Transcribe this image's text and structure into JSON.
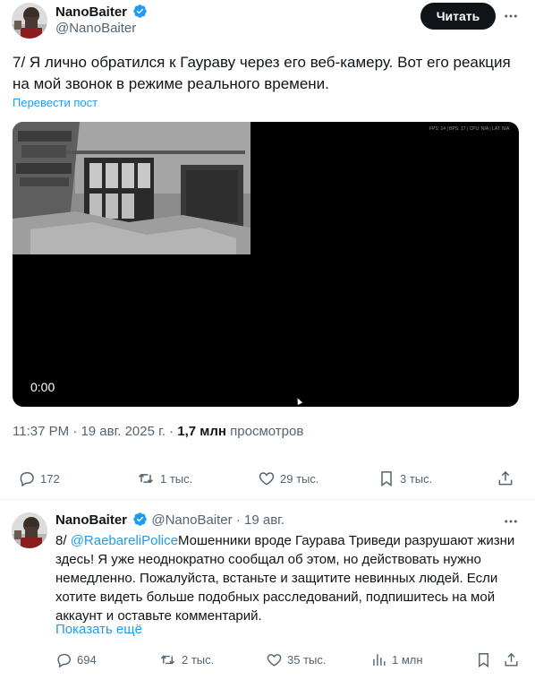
{
  "post": {
    "author_name": "NanoBaiter",
    "author_handle": "@NanoBaiter",
    "follow_label": "Читать",
    "text": "7/ Я лично обратился к Гаураву через его веб-камеру. Вот его реакция на мой звонок в режиме реального времени.",
    "translate_label": "Перевести пост",
    "video": {
      "timecode": "0:00",
      "stats_overlay": "FPS: 14 | BPS: 17 | CPU: N/A | LAT: N/A"
    },
    "time": "11:37 PM",
    "date": "19 авг. 2025 г.",
    "views_count": "1,7 млн",
    "views_label": "просмотров",
    "actions": {
      "replies": "172",
      "reposts": "1 тыс.",
      "likes": "29 тыс.",
      "bookmarks": "3 тыс."
    }
  },
  "reply": {
    "author_name": "NanoBaiter",
    "author_handle": "@NanoBaiter",
    "date": "19 авг.",
    "number": "8/",
    "mention": "@RaebareliPolice",
    "text": "Мошенники вроде Гаурава Триведи разрушают жизни здесь! Я уже неоднократно сообщал об этом, но действовать нужно немедленно. Пожалуйста, встаньте и защитите невинных людей. Если хотите видеть больше подобных расследований, подпишитесь на мой аккаунт и оставьте комментарий.",
    "show_more": "Показать ещё",
    "actions": {
      "replies": "694",
      "reposts": "2 тыс.",
      "likes": "35 тыс.",
      "views": "1 млн"
    }
  },
  "colors": {
    "accent": "#1d9bf0",
    "text": "#0f1419",
    "secondary": "#536471",
    "button": "#0f1419"
  },
  "icons": {
    "verified": "verified-badge-icon",
    "more": "more-horizontal-icon",
    "reply": "comment-bubble-icon",
    "repost": "repost-arrows-icon",
    "like": "heart-icon",
    "bookmark": "bookmark-icon",
    "share": "share-upload-icon",
    "views": "bar-chart-icon"
  }
}
